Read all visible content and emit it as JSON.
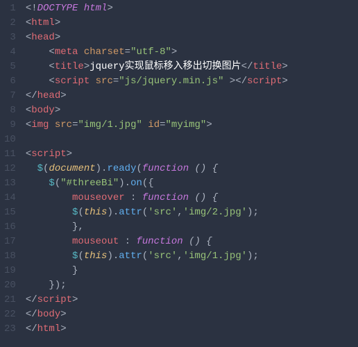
{
  "lines": [
    {
      "n": "1",
      "segs": [
        {
          "c": "p",
          "t": "<!"
        },
        {
          "c": "v",
          "t": "DOCTYPE html"
        },
        {
          "c": "p",
          "t": ">"
        }
      ]
    },
    {
      "n": "2",
      "segs": [
        {
          "c": "p",
          "t": "<"
        },
        {
          "c": "t",
          "t": "html"
        },
        {
          "c": "p",
          "t": ">"
        }
      ]
    },
    {
      "n": "3",
      "segs": [
        {
          "c": "p",
          "t": "<"
        },
        {
          "c": "t",
          "t": "head"
        },
        {
          "c": "p",
          "t": ">"
        }
      ]
    },
    {
      "n": "4",
      "segs": [
        {
          "c": "p",
          "t": "    <"
        },
        {
          "c": "t",
          "t": "meta"
        },
        {
          "c": "p",
          "t": " "
        },
        {
          "c": "a",
          "t": "charset"
        },
        {
          "c": "p",
          "t": "="
        },
        {
          "c": "s",
          "t": "\"utf-8\""
        },
        {
          "c": "p",
          "t": ">"
        }
      ]
    },
    {
      "n": "5",
      "segs": [
        {
          "c": "p",
          "t": "    <"
        },
        {
          "c": "t",
          "t": "title"
        },
        {
          "c": "p",
          "t": ">"
        },
        {
          "c": "w",
          "t": "jquery实现鼠标移入移出切换图片"
        },
        {
          "c": "p",
          "t": "</"
        },
        {
          "c": "t",
          "t": "title"
        },
        {
          "c": "p",
          "t": ">"
        }
      ]
    },
    {
      "n": "6",
      "segs": [
        {
          "c": "p",
          "t": "    <"
        },
        {
          "c": "t",
          "t": "script"
        },
        {
          "c": "p",
          "t": " "
        },
        {
          "c": "a",
          "t": "src"
        },
        {
          "c": "p",
          "t": "="
        },
        {
          "c": "s",
          "t": "\"js/jquery.min.js\""
        },
        {
          "c": "p",
          "t": " ></"
        },
        {
          "c": "t",
          "t": "script"
        },
        {
          "c": "p",
          "t": ">"
        }
      ]
    },
    {
      "n": "7",
      "segs": [
        {
          "c": "p",
          "t": "</"
        },
        {
          "c": "t",
          "t": "head"
        },
        {
          "c": "p",
          "t": ">"
        }
      ]
    },
    {
      "n": "8",
      "segs": [
        {
          "c": "p",
          "t": "<"
        },
        {
          "c": "t",
          "t": "body"
        },
        {
          "c": "p",
          "t": ">"
        }
      ]
    },
    {
      "n": "9",
      "segs": [
        {
          "c": "p",
          "t": "<"
        },
        {
          "c": "t",
          "t": "img"
        },
        {
          "c": "p",
          "t": " "
        },
        {
          "c": "a",
          "t": "src"
        },
        {
          "c": "p",
          "t": "="
        },
        {
          "c": "s",
          "t": "\"img/1.jpg\""
        },
        {
          "c": "p",
          "t": " "
        },
        {
          "c": "a",
          "t": "id"
        },
        {
          "c": "p",
          "t": "="
        },
        {
          "c": "s",
          "t": "\"myimg\""
        },
        {
          "c": "p",
          "t": ">"
        }
      ]
    },
    {
      "n": "10",
      "segs": [
        {
          "c": "p",
          "t": ""
        }
      ]
    },
    {
      "n": "11",
      "segs": [
        {
          "c": "p",
          "t": "<"
        },
        {
          "c": "t",
          "t": "script"
        },
        {
          "c": "p",
          "t": ">"
        }
      ]
    },
    {
      "n": "12",
      "segs": [
        {
          "c": "p",
          "t": "  "
        },
        {
          "c": "jq",
          "t": "$"
        },
        {
          "c": "p",
          "t": "("
        },
        {
          "c": "vv",
          "t": "document"
        },
        {
          "c": "p",
          "t": ")."
        },
        {
          "c": "f",
          "t": "ready"
        },
        {
          "c": "p",
          "t": "("
        },
        {
          "c": "k i",
          "t": "function"
        },
        {
          "c": "p i",
          "t": " () {"
        }
      ]
    },
    {
      "n": "13",
      "segs": [
        {
          "c": "p",
          "t": "    "
        },
        {
          "c": "jq",
          "t": "$"
        },
        {
          "c": "p",
          "t": "("
        },
        {
          "c": "s",
          "t": "\"#threeBi\""
        },
        {
          "c": "p",
          "t": ")."
        },
        {
          "c": "f",
          "t": "on"
        },
        {
          "c": "p",
          "t": "({"
        }
      ]
    },
    {
      "n": "14",
      "segs": [
        {
          "c": "p",
          "t": "        "
        },
        {
          "c": "t",
          "t": "mouseover"
        },
        {
          "c": "p",
          "t": " : "
        },
        {
          "c": "k i",
          "t": "function"
        },
        {
          "c": "p i",
          "t": " () {"
        }
      ]
    },
    {
      "n": "15",
      "segs": [
        {
          "c": "p",
          "t": "        "
        },
        {
          "c": "jq",
          "t": "$"
        },
        {
          "c": "p",
          "t": "("
        },
        {
          "c": "vv",
          "t": "this"
        },
        {
          "c": "p",
          "t": ")."
        },
        {
          "c": "f",
          "t": "attr"
        },
        {
          "c": "p",
          "t": "("
        },
        {
          "c": "s",
          "t": "'src'"
        },
        {
          "c": "p",
          "t": ","
        },
        {
          "c": "s",
          "t": "'img/2.jpg'"
        },
        {
          "c": "p",
          "t": ");"
        }
      ]
    },
    {
      "n": "16",
      "segs": [
        {
          "c": "p",
          "t": "        },"
        }
      ]
    },
    {
      "n": "17",
      "segs": [
        {
          "c": "p",
          "t": "        "
        },
        {
          "c": "t",
          "t": "mouseout"
        },
        {
          "c": "p",
          "t": " : "
        },
        {
          "c": "k i",
          "t": "function"
        },
        {
          "c": "p i",
          "t": " () {"
        }
      ]
    },
    {
      "n": "18",
      "segs": [
        {
          "c": "p",
          "t": "        "
        },
        {
          "c": "jq",
          "t": "$"
        },
        {
          "c": "p",
          "t": "("
        },
        {
          "c": "vv",
          "t": "this"
        },
        {
          "c": "p",
          "t": ")."
        },
        {
          "c": "f",
          "t": "attr"
        },
        {
          "c": "p",
          "t": "("
        },
        {
          "c": "s",
          "t": "'src'"
        },
        {
          "c": "p",
          "t": ","
        },
        {
          "c": "s",
          "t": "'img/1.jpg'"
        },
        {
          "c": "p",
          "t": ");"
        }
      ]
    },
    {
      "n": "19",
      "segs": [
        {
          "c": "p",
          "t": "        }"
        }
      ]
    },
    {
      "n": "20",
      "segs": [
        {
          "c": "p",
          "t": "    });"
        }
      ]
    },
    {
      "n": "21",
      "segs": [
        {
          "c": "p",
          "t": "</"
        },
        {
          "c": "t",
          "t": "script"
        },
        {
          "c": "p",
          "t": ">"
        }
      ]
    },
    {
      "n": "22",
      "segs": [
        {
          "c": "p",
          "t": "</"
        },
        {
          "c": "t",
          "t": "body"
        },
        {
          "c": "p",
          "t": ">"
        }
      ]
    },
    {
      "n": "23",
      "segs": [
        {
          "c": "p",
          "t": "</"
        },
        {
          "c": "t",
          "t": "html"
        },
        {
          "c": "p",
          "t": ">"
        }
      ]
    }
  ]
}
